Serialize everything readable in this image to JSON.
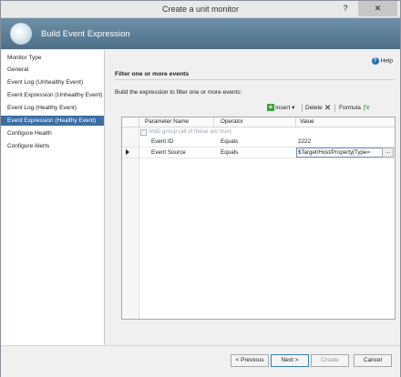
{
  "window": {
    "title": "Create a unit monitor",
    "help_btn": "?",
    "close_btn": "✕"
  },
  "banner": {
    "title": "Build Event Expression"
  },
  "sidebar": {
    "items": [
      {
        "label": "Monitor Type",
        "selected": false
      },
      {
        "label": "General",
        "selected": false
      },
      {
        "label": "Event Log (Unhealthy Event)",
        "selected": false
      },
      {
        "label": "Event Expression (Unhealthy Event)",
        "selected": false
      },
      {
        "label": "Event Log (Healthy Event)",
        "selected": false
      },
      {
        "label": "Event Expression (Healthy Event)",
        "selected": true
      },
      {
        "label": "Configure Health",
        "selected": false
      },
      {
        "label": "Configure Alerts",
        "selected": false
      }
    ]
  },
  "main": {
    "help": "Help",
    "section_title": "Filter one or more events",
    "instruction": "Build the expression to filter one or more events:",
    "toolbar": {
      "insert": "Insert",
      "delete": "Delete",
      "formula": "Formula"
    },
    "grid": {
      "columns": [
        "Parameter Name",
        "Operator",
        "Value"
      ],
      "group_label": "AND group (all of these are true)",
      "rows": [
        {
          "parameter": "Event ID",
          "operator": "Equals",
          "value": "2222"
        },
        {
          "parameter": "Event Source",
          "operator": "Equals",
          "value": "$Target/Host/Property[Type="
        }
      ],
      "ellipsis": "..."
    }
  },
  "footer": {
    "previous": "< Previous",
    "next": "Next >",
    "create": "Create",
    "cancel": "Cancel"
  },
  "colors": {
    "selection": "#3b6ea5",
    "banner": "#5b7d97",
    "add_icon": "#3aa13a"
  },
  "icons": {
    "help": "help-icon",
    "insert": "plus-icon",
    "delete": "delete-x-icon",
    "formula": "formula-icon",
    "banner": "monitor-icon"
  }
}
